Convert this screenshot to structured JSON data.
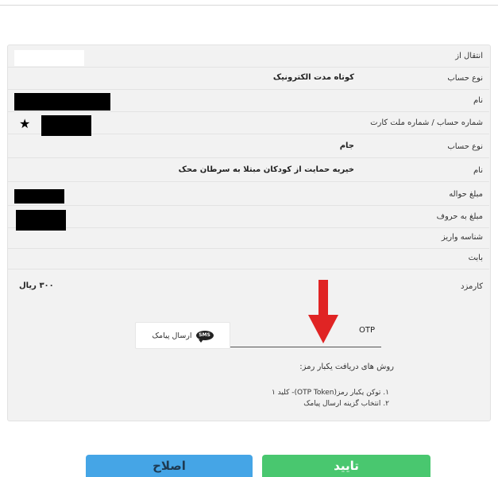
{
  "rows": [
    {
      "label": "انتقال از",
      "value": ""
    },
    {
      "label": "نوع حساب",
      "value": "کوتاه مدت الکترونیک"
    },
    {
      "label": "نام",
      "value": ""
    },
    {
      "label": "شماره حساب / شماره ملت کارت",
      "value": ""
    },
    {
      "label": "نوع حساب",
      "value": "جام"
    },
    {
      "label": "نام",
      "value": "خیریه حمایت از کودکان مبتلا به سرطان محک"
    },
    {
      "label": "مبلغ حواله",
      "value": ""
    },
    {
      "label": "مبلغ به حروف",
      "value": ""
    },
    {
      "label": "شناسه واریز",
      "value": ""
    },
    {
      "label": "بابت",
      "value": ""
    },
    {
      "label": "کارمزد",
      "value": "۳۰۰ ریال"
    }
  ],
  "otp": {
    "label": "OTP",
    "value": ""
  },
  "sms_button": {
    "icon_text": "SMS",
    "label": "ارسال پیامک"
  },
  "methods": {
    "title": "روش های دریافت یکبار رمز:",
    "items": [
      "۱. توکن یکبار رمز(OTP Token)- کلید ۱",
      "۲. انتخاب گزینه ارسال پیامک"
    ]
  },
  "buttons": {
    "confirm": "تایید",
    "edit": "اصلاح"
  },
  "colors": {
    "confirm": "#49c76f",
    "edit": "#45a5e6",
    "arrow": "#e02424"
  }
}
